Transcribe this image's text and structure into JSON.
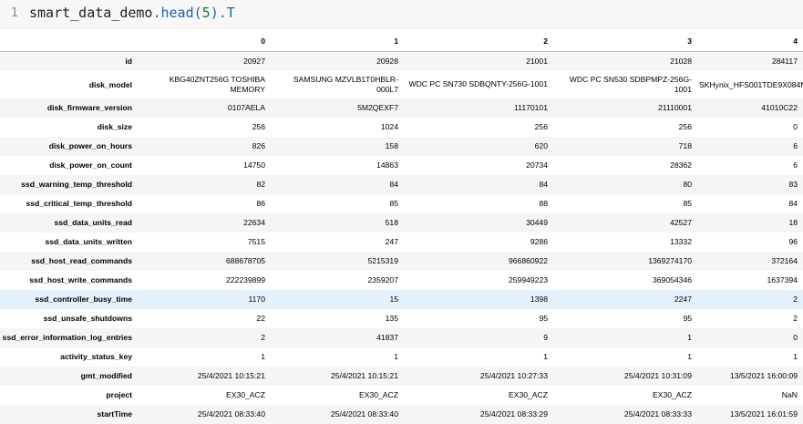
{
  "input": {
    "line_number": "1",
    "code_object": "smart_data_demo",
    "code_method": ".head(",
    "code_arg": "5",
    "code_close": ")",
    "code_attr": ".T"
  },
  "table": {
    "columns": [
      "0",
      "1",
      "2",
      "3",
      "4"
    ],
    "rows": [
      {
        "label": "id",
        "values": [
          "20927",
          "20928",
          "21001",
          "21028",
          "284117"
        ]
      },
      {
        "label": "disk_model",
        "values": [
          "KBG40ZNT256G TOSHIBA MEMORY",
          "SAMSUNG MZVLB1T0HBLR-000L7",
          "WDC PC SN730 SDBQNTY-256G-1001",
          "WDC PC SN530 SDBPMPZ-256G-1001",
          "SKHynix_HFS001TDE9X084N"
        ]
      },
      {
        "label": "disk_firmware_version",
        "values": [
          "0107AELA",
          "5M2QEXF7",
          "11170101",
          "21110001",
          "41010C22"
        ]
      },
      {
        "label": "disk_size",
        "values": [
          "256",
          "1024",
          "256",
          "256",
          "0"
        ]
      },
      {
        "label": "disk_power_on_hours",
        "values": [
          "826",
          "158",
          "620",
          "718",
          "6"
        ]
      },
      {
        "label": "disk_power_on_count",
        "values": [
          "14750",
          "14863",
          "20734",
          "28362",
          "6"
        ]
      },
      {
        "label": "ssd_warning_temp_threshold",
        "values": [
          "82",
          "84",
          "84",
          "80",
          "83"
        ]
      },
      {
        "label": "ssd_critical_temp_threshold",
        "values": [
          "86",
          "85",
          "88",
          "85",
          "84"
        ]
      },
      {
        "label": "ssd_data_units_read",
        "values": [
          "22634",
          "518",
          "30449",
          "42527",
          "18"
        ]
      },
      {
        "label": "ssd_data_units_written",
        "values": [
          "7515",
          "247",
          "9286",
          "13332",
          "96"
        ]
      },
      {
        "label": "ssd_host_read_commands",
        "values": [
          "688678705",
          "5215319",
          "966860922",
          "1369274170",
          "372164"
        ]
      },
      {
        "label": "ssd_host_write_commands",
        "values": [
          "222239899",
          "2359207",
          "259949223",
          "369054346",
          "1637394"
        ]
      },
      {
        "label": "ssd_controller_busy_time",
        "values": [
          "1170",
          "15",
          "1398",
          "2247",
          "2"
        ]
      },
      {
        "label": "ssd_unsafe_shutdowns",
        "values": [
          "22",
          "135",
          "95",
          "95",
          "2"
        ]
      },
      {
        "label": "ssd_error_information_log_entries",
        "values": [
          "2",
          "41837",
          "9",
          "1",
          "0"
        ]
      },
      {
        "label": "activity_status_key",
        "values": [
          "1",
          "1",
          "1",
          "1",
          "1"
        ]
      },
      {
        "label": "gmt_modified",
        "values": [
          "25/4/2021 10:15:21",
          "25/4/2021 10:15:21",
          "25/4/2021 10:27:33",
          "25/4/2021 10:31:09",
          "13/5/2021 16:00:09"
        ]
      },
      {
        "label": "project",
        "values": [
          "EX30_ACZ",
          "EX30_ACZ",
          "EX30_ACZ",
          "EX30_ACZ",
          "NaN"
        ]
      },
      {
        "label": "startTime",
        "values": [
          "25/4/2021 08:33:40",
          "25/4/2021 08:33:40",
          "25/4/2021 08:33:29",
          "25/4/2021 08:33:33",
          "13/5/2021 16:01:59"
        ]
      }
    ]
  },
  "colors": {
    "input_background": "#f7f7f7",
    "striped_row": "#f5f5f5",
    "highlight_row": "#e3f2fd",
    "code_attribute": "#1a62b8",
    "code_number": "#0a7f35"
  }
}
